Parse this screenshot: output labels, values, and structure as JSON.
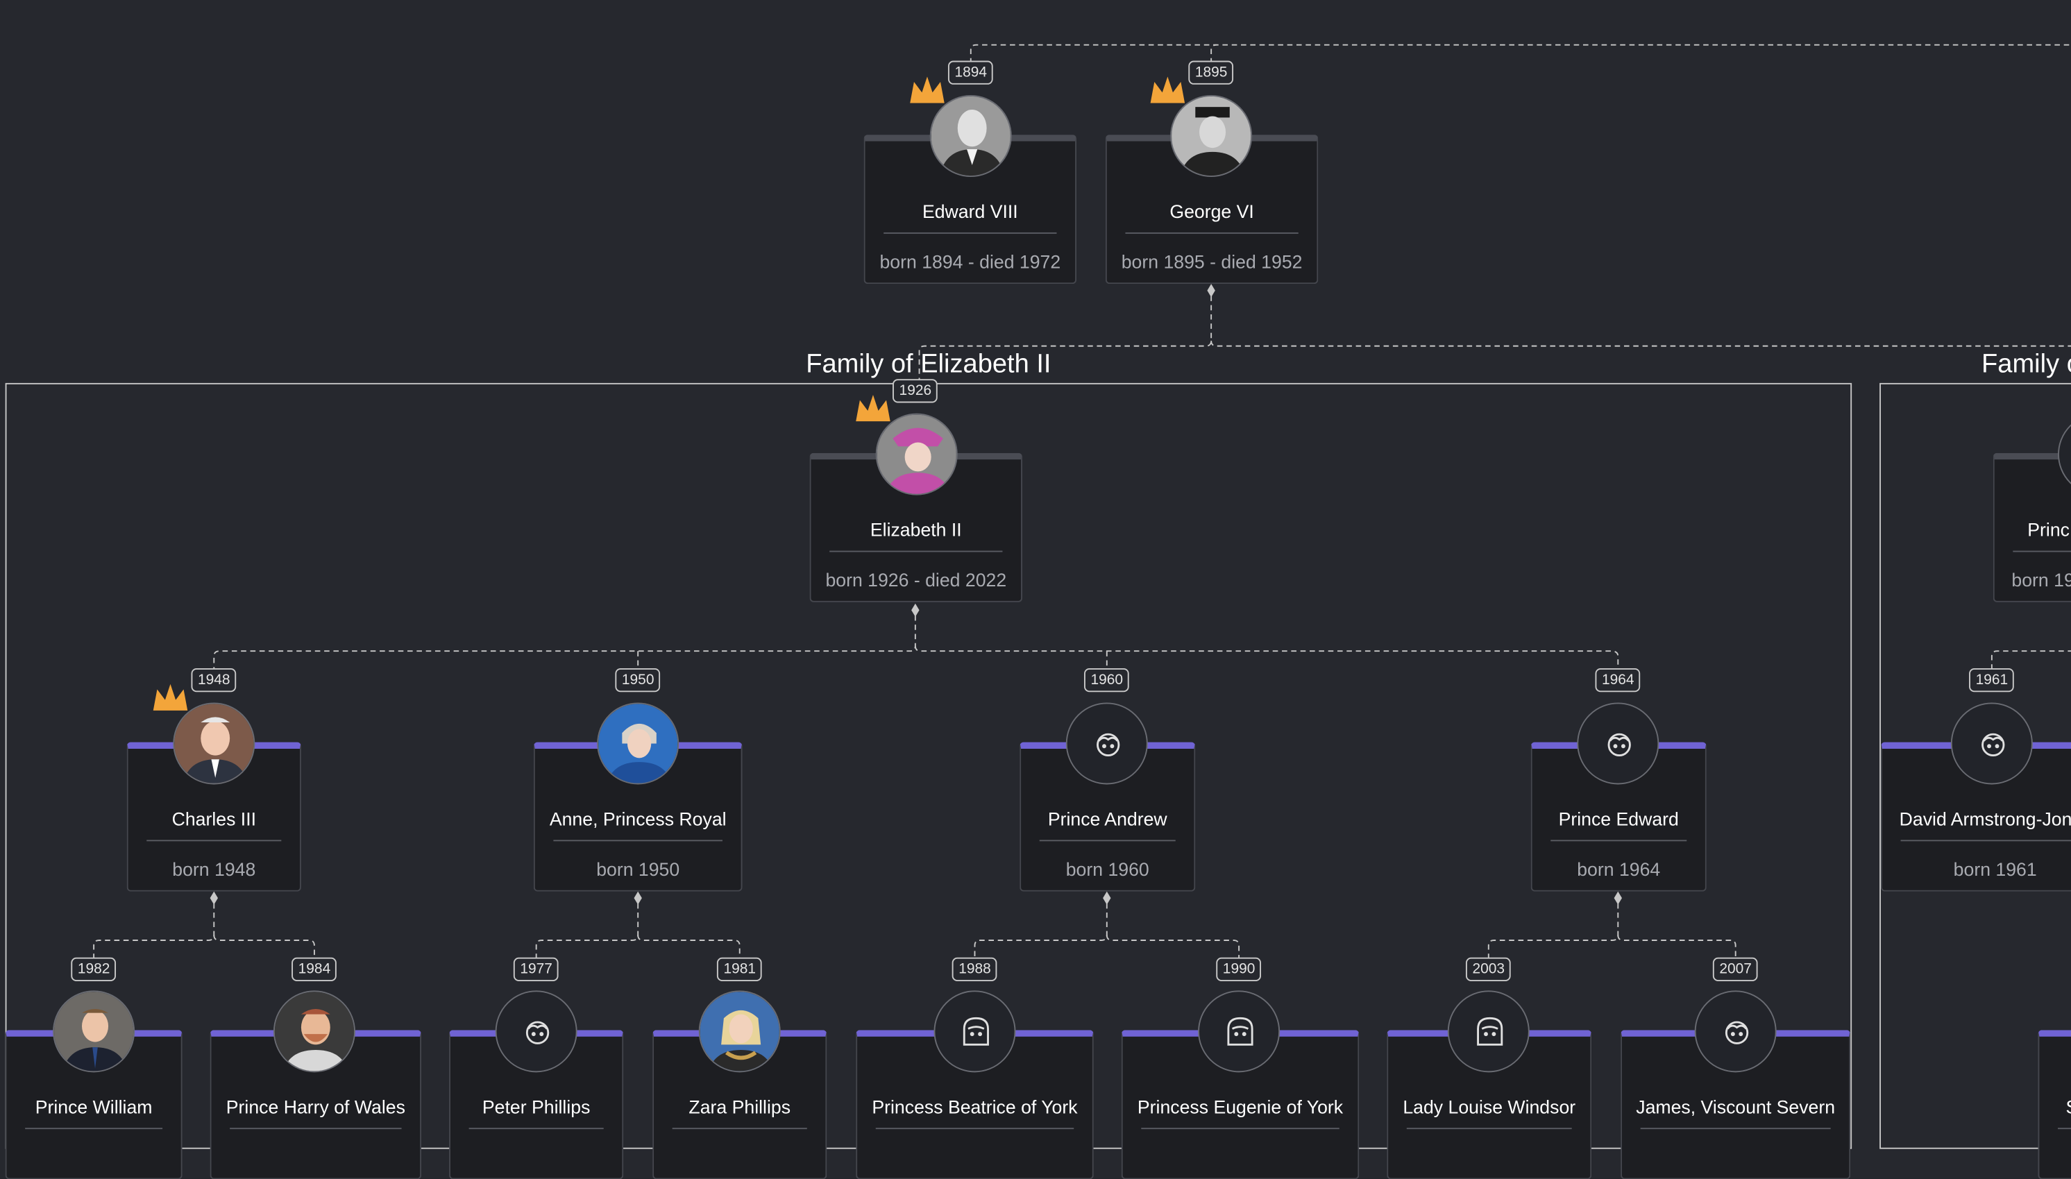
{
  "colors": {
    "background": "#26282e",
    "card": "#1d1e22",
    "accent": "#7063d4",
    "crown": "#f3a53a",
    "connector": "#c8c8c8"
  },
  "groups": [
    {
      "title": "Family of Elizabeth II"
    },
    {
      "title": "Family o"
    }
  ],
  "people": {
    "edward_viii": {
      "name": "Edward VIII",
      "dates": "born 1894 - died 1972",
      "year": "1894"
    },
    "george_vi": {
      "name": "George VI",
      "dates": "born 1895 - died 1952",
      "year": "1895"
    },
    "elizabeth_ii": {
      "name": "Elizabeth II",
      "dates": "born 1926 - died 2022",
      "year": "1926"
    },
    "charles_iii": {
      "name": "Charles III",
      "dates": "born 1948",
      "year": "1948"
    },
    "anne": {
      "name": "Anne, Princess Royal",
      "dates": "born 1950",
      "year": "1950"
    },
    "andrew": {
      "name": "Prince Andrew",
      "dates": "born 1960",
      "year": "1960"
    },
    "edward": {
      "name": "Prince Edward",
      "dates": "born 1964",
      "year": "1964"
    },
    "william": {
      "name": "Prince William",
      "dates": "",
      "year": "1982"
    },
    "harry": {
      "name": "Prince Harry of Wales",
      "dates": "",
      "year": "1984"
    },
    "peter": {
      "name": "Peter Phillips",
      "dates": "",
      "year": "1977"
    },
    "zara": {
      "name": "Zara Phillips",
      "dates": "",
      "year": "1981"
    },
    "beatrice": {
      "name": "Princess Beatrice of York",
      "dates": "",
      "year": "1988"
    },
    "eugenie": {
      "name": "Princess Eugenie of York",
      "dates": "",
      "year": "1990"
    },
    "louise": {
      "name": "Lady Louise Windsor",
      "dates": "",
      "year": "2003"
    },
    "james": {
      "name": "James, Viscount Severn",
      "dates": "",
      "year": "2007"
    },
    "david": {
      "name": "David Armstrong-Jone",
      "dates": "born 1961",
      "year": "1961"
    },
    "partial_upper": {
      "name": "Princ",
      "dates": "born 19",
      "year": ""
    },
    "partial_lower": {
      "name": "S",
      "dates": "",
      "year": ""
    }
  },
  "icons": {
    "crown": "crown-icon",
    "boy": "boy-face-icon",
    "girl": "girl-face-icon",
    "photo": "portrait-photo"
  }
}
